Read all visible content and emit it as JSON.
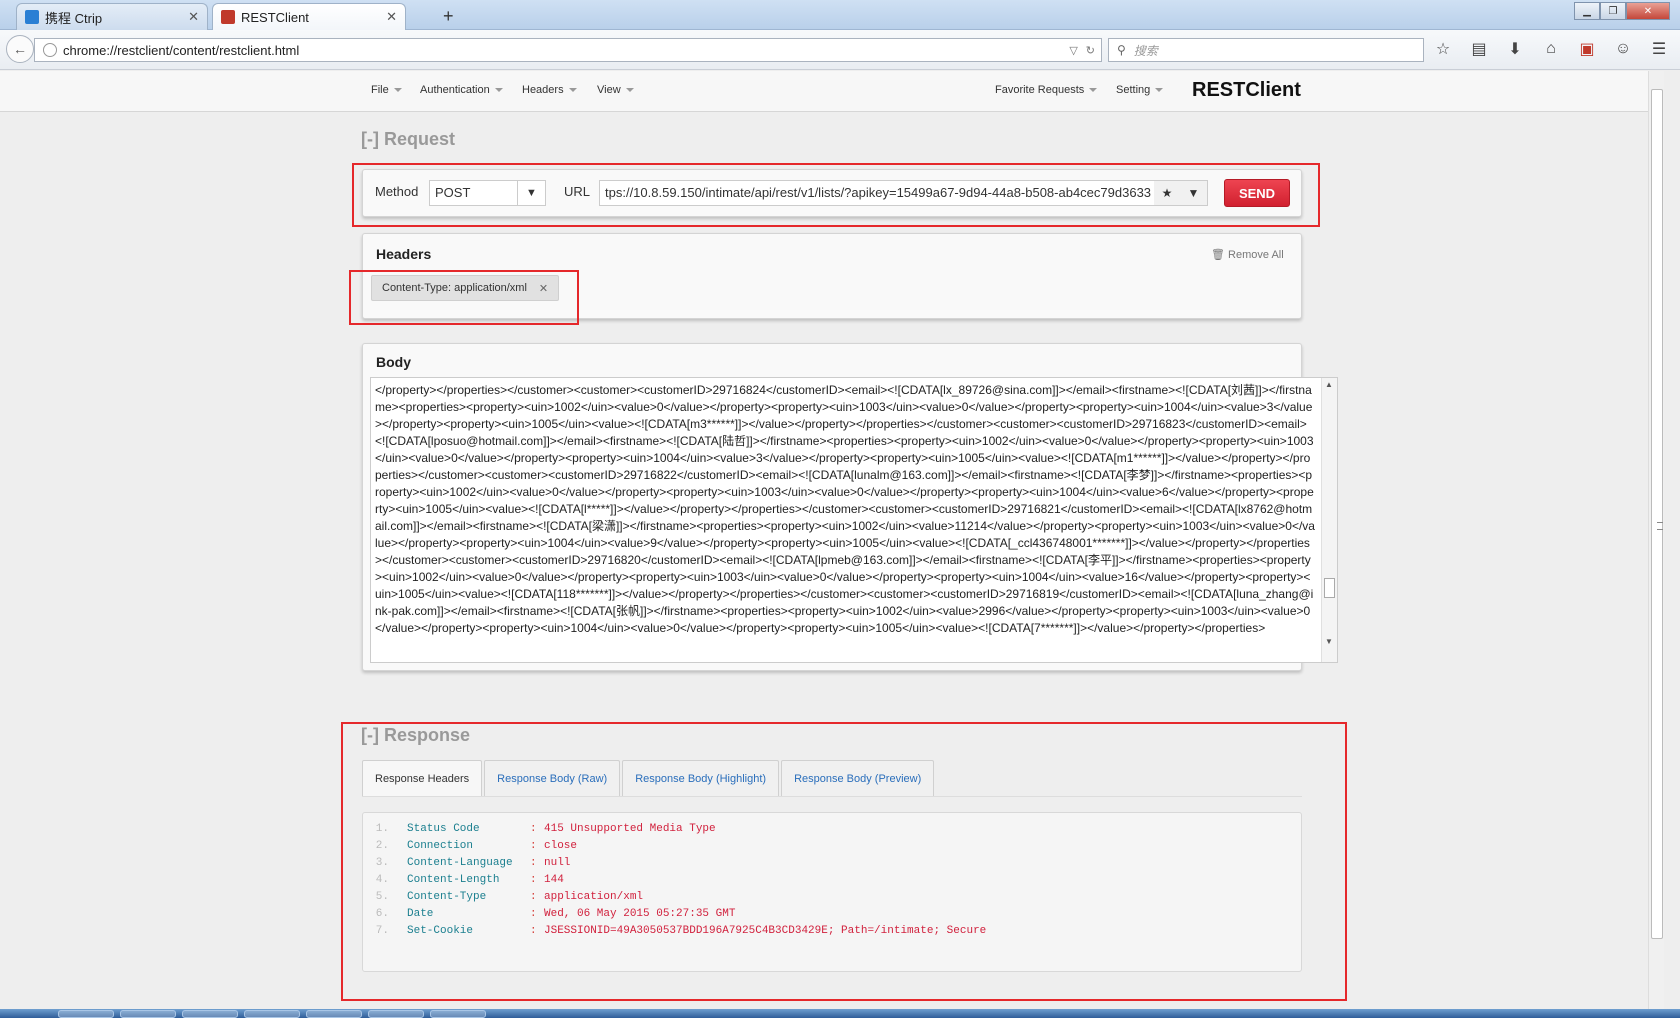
{
  "browser": {
    "tabs": [
      {
        "label": "携程 Ctrip",
        "icon": "ctrip-logo-icon"
      },
      {
        "label": "RESTClient",
        "icon": "restclient-logo-icon"
      }
    ],
    "url": "chrome://restclient/content/restclient.html",
    "search_placeholder": "搜索"
  },
  "menu": {
    "left": [
      "File",
      "Authentication",
      "Headers",
      "View"
    ],
    "right": [
      "Favorite Requests",
      "Setting"
    ],
    "brand": "RESTClient"
  },
  "request": {
    "section_title": "[-] Request",
    "method_label": "Method",
    "method_value": "POST",
    "url_label": "URL",
    "url_value": "tps://10.8.59.150/intimate/api/rest/v1/lists/?apikey=15499a67-9d94-44a8-b508-ab4cec79d3633",
    "send_label": "SEND"
  },
  "headers": {
    "title": "Headers",
    "remove_all": "Remove All",
    "items": [
      "Content-Type: application/xml"
    ]
  },
  "body": {
    "title": "Body",
    "text": "</property></properties></customer><customer><customerID>29716824</customerID><email><![CDATA[lx_89726@sina.com]]></email><firstname><![CDATA[刘茜]]></firstname><properties><property><uin>1002</uin><value>0</value></property><property><uin>1003</uin><value>0</value></property><property><uin>1004</uin><value>3</value></property><property><uin>1005</uin><value><![CDATA[m3******]]></value></property></properties></customer><customer><customerID>29716823</customerID><email><![CDATA[lposuo@hotmail.com]]></email><firstname><![CDATA[陆哲]]></firstname><properties><property><uin>1002</uin><value>0</value></property><property><uin>1003</uin><value>0</value></property><property><uin>1004</uin><value>3</value></property><property><uin>1005</uin><value><![CDATA[m1******]]></value></property></properties></customer><customer><customerID>29716822</customerID><email><![CDATA[lunalm@163.com]]></email><firstname><![CDATA[李梦]]></firstname><properties><property><uin>1002</uin><value>0</value></property><property><uin>1003</uin><value>0</value></property><property><uin>1004</uin><value>6</value></property><property><uin>1005</uin><value><![CDATA[l*****]]></value></property></properties></customer><customer><customerID>29716821</customerID><email><![CDATA[lx8762@hotmail.com]]></email><firstname><![CDATA[梁潇]]></firstname><properties><property><uin>1002</uin><value>11214</value></property><property><uin>1003</uin><value>0</value></property><property><uin>1004</uin><value>9</value></property><property><uin>1005</uin><value><![CDATA[_ccl436748001*******]]></value></property></properties></customer><customer><customerID>29716820</customerID><email><![CDATA[lpmeb@163.com]]></email><firstname><![CDATA[李平]]></firstname><properties><property><uin>1002</uin><value>0</value></property><property><uin>1003</uin><value>0</value></property><property><uin>1004</uin><value>16</value></property><property><uin>1005</uin><value><![CDATA[118*******]]></value></property></properties></customer><customer><customerID>29716819</customerID><email><![CDATA[luna_zhang@ink-pak.com]]></email><firstname><![CDATA[张帆]]></firstname><properties><property><uin>1002</uin><value>2996</value></property><property><uin>1003</uin><value>0</value></property><property><uin>1004</uin><value>0</value></property><property><uin>1005</uin><value><![CDATA[7*******]]></value></property></properties>"
  },
  "response": {
    "section_title": "[-] Response",
    "tabs": [
      "Response Headers",
      "Response Body (Raw)",
      "Response Body (Highlight)",
      "Response Body (Preview)"
    ],
    "rows": [
      {
        "num": "1.",
        "key": "Status Code",
        "value": "415 Unsupported Media Type"
      },
      {
        "num": "2.",
        "key": "Connection",
        "value": "close"
      },
      {
        "num": "3.",
        "key": "Content-Language",
        "value": "null"
      },
      {
        "num": "4.",
        "key": "Content-Length",
        "value": "144"
      },
      {
        "num": "5.",
        "key": "Content-Type",
        "value": "application/xml"
      },
      {
        "num": "6.",
        "key": "Date",
        "value": "Wed, 06 May 2015 05:27:35 GMT"
      },
      {
        "num": "7.",
        "key": "Set-Cookie",
        "value": "JSESSIONID=49A3050537BDD196A7925C4B3CD3429E; Path=/intimate; Secure"
      }
    ]
  },
  "colors": {
    "send": "#d1202f",
    "highlight_box": "#e5282b",
    "resp_key": "#1b7f8f",
    "resp_value": "#d1213d",
    "tab_link": "#2a6ebb"
  }
}
